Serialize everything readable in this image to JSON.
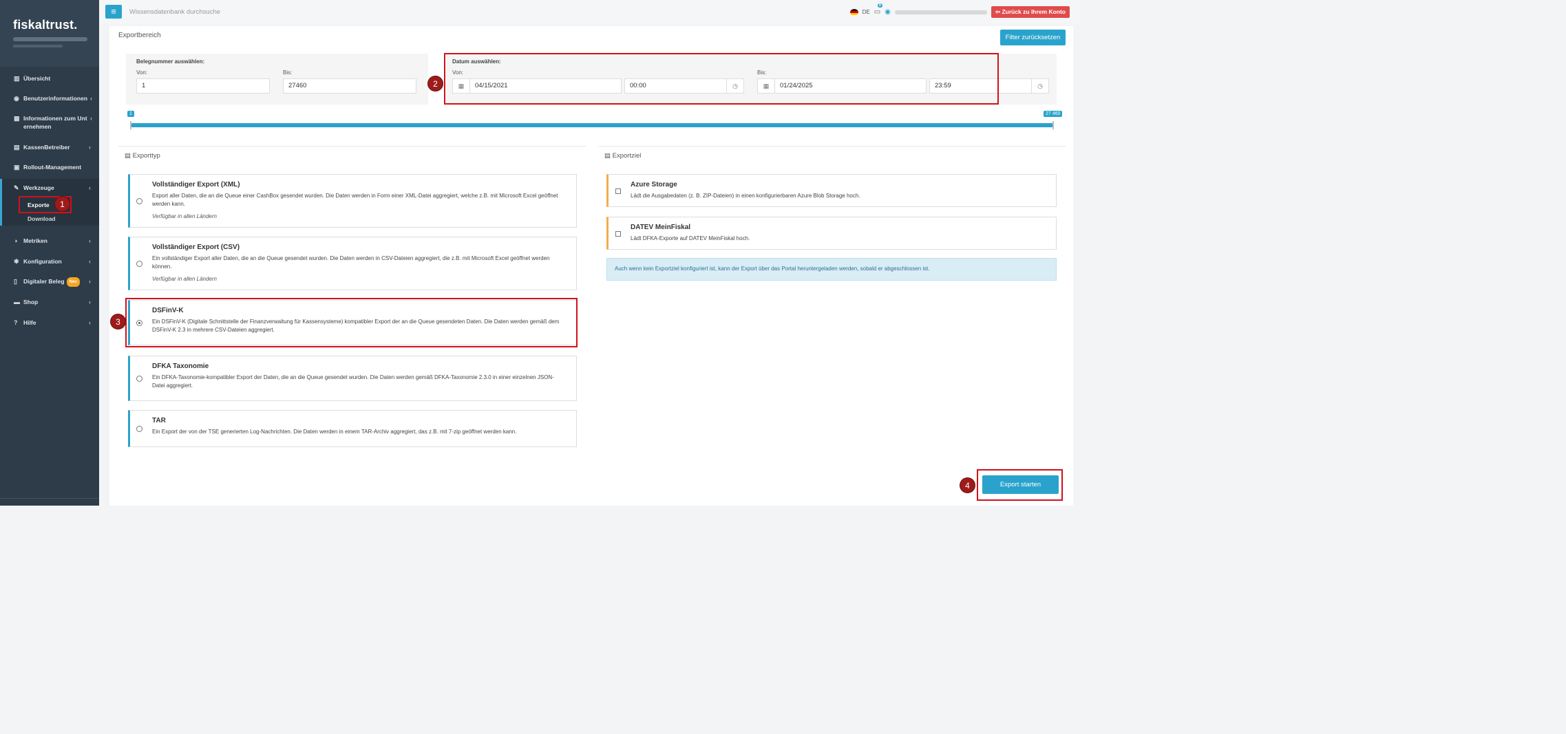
{
  "sidebar": {
    "logo": "fiskaltrust.",
    "items": [
      {
        "icon": "▥",
        "label": "Übersicht",
        "chevron": ""
      },
      {
        "icon": "◉",
        "label": "Benutzerinformationen",
        "chevron": "‹"
      },
      {
        "icon": "▦",
        "label": "Informationen zum Unternehmen",
        "chevron": "‹"
      },
      {
        "icon": "▤",
        "label": "KassenBetreiber",
        "chevron": "‹"
      },
      {
        "icon": "▣",
        "label": "Rollout-Management",
        "chevron": ""
      },
      {
        "icon": "✎",
        "label": "Werkzeuge",
        "chevron": "‹"
      },
      {
        "icon": "◑",
        "label": "Metriken",
        "chevron": "‹"
      },
      {
        "icon": "✱",
        "label": "Konfiguration",
        "chevron": "‹"
      },
      {
        "icon": "▯",
        "label": "Digitaler Beleg",
        "chevron": "‹"
      },
      {
        "icon": "▬",
        "label": "Shop",
        "chevron": "‹"
      },
      {
        "icon": "?",
        "label": "Hilfe",
        "chevron": "‹"
      }
    ],
    "info_line1": "Informationen zum Unt",
    "info_line2": "ernehmen",
    "new_badge": "Neu",
    "subitems": {
      "exporte": "Exporte",
      "download": "Download"
    }
  },
  "topbar": {
    "menu_icon": "≡",
    "search_placeholder": "Wissensdatenbank durchsuche",
    "language": "DE",
    "cart_count": "0",
    "back_button": "Zurück zu Ihrem Konto",
    "back_icon": "⇦"
  },
  "export": {
    "title": "Exportbereich",
    "filter_reset": "Filter zurücksetzen",
    "receipt": {
      "heading": "Belegnummer auswählen:",
      "from_label": "Von:",
      "to_label": "Bis:",
      "from_value": "1",
      "to_value": "27460"
    },
    "date": {
      "heading": "Datum auswählen:",
      "from_label": "Von:",
      "to_label": "Bis:",
      "from_date": "04/15/2021",
      "from_time": "00:00",
      "to_date": "01/24/2025",
      "to_time": "23:59"
    },
    "slider": {
      "min_label": "1",
      "max_label": "27 460"
    },
    "type_heading": "Exporttyp",
    "target_heading": "Exportziel",
    "types": [
      {
        "title": "Vollständiger Export (XML)",
        "desc": "Export aller Daten, die an die Queue einer CashBox gesendet wurden. Die Daten werden in Form einer XML-Datei aggregiert, welche z.B. mit Microsoft Excel geöffnet werden kann.",
        "note": "Verfügbar in allen Ländern",
        "selected": false
      },
      {
        "title": "Vollständiger Export (CSV)",
        "desc": "Ein vollständiger Export aller Daten, die an die Queue gesendet wurden. Die Daten werden in CSV-Dateien aggregiert, die z.B. mit Microsoft Excel geöffnet werden können.",
        "note": "Verfügbar in allen Ländern",
        "selected": false
      },
      {
        "title": "DSFinV-K",
        "desc": "Ein DSFinV-K (Digitale Schnittstelle der Finanzverwaltung für Kassensysteme) kompatibler Export der an die Queue gesendeten Daten. Die Daten werden gemäß dem DSFinV-K 2.3 in mehrere CSV-Dateien aggregiert.",
        "note": "",
        "selected": true
      },
      {
        "title": "DFKA Taxonomie",
        "desc": "Ein DFKA-Taxonomie-kompatibler Export der Daten, die an die Queue gesendet wurden. Die Daten werden gemäß DFKA-Taxonomie 2.3.0 in einer einzelnen JSON-Datei aggregiert.",
        "note": "",
        "selected": false
      },
      {
        "title": "TAR",
        "desc": "Ein Export der von der TSE generierten Log-Nachrichten. Die Daten werden in einem TAR-Archiv aggregiert, das z.B. mit 7-zip geöffnet werden kann.",
        "note": "",
        "selected": false
      }
    ],
    "targets": [
      {
        "title": "Azure Storage",
        "desc": "Lädt die Ausgabedaten (z. B. ZIP-Dateien) in einen konfigurierbaren Azure Blob Storage hoch."
      },
      {
        "title": "DATEV MeinFiskal",
        "desc": "Lädt DFKA-Exporte auf DATEV MeinFiskal hoch."
      }
    ],
    "info": "Auch wenn kein Exportziel konfiguriert ist, kann der Export über das Portal heruntergeladen werden, sobald er abgeschlossen ist.",
    "start_button": "Export starten"
  },
  "markers": [
    "1",
    "2",
    "3",
    "4"
  ],
  "colors": {
    "accent": "#2aa3cc",
    "sidebar": "#2e3b48",
    "highlight": "#d0111b",
    "back_button": "#e04b4b",
    "warning_border": "#f0ad4e"
  }
}
